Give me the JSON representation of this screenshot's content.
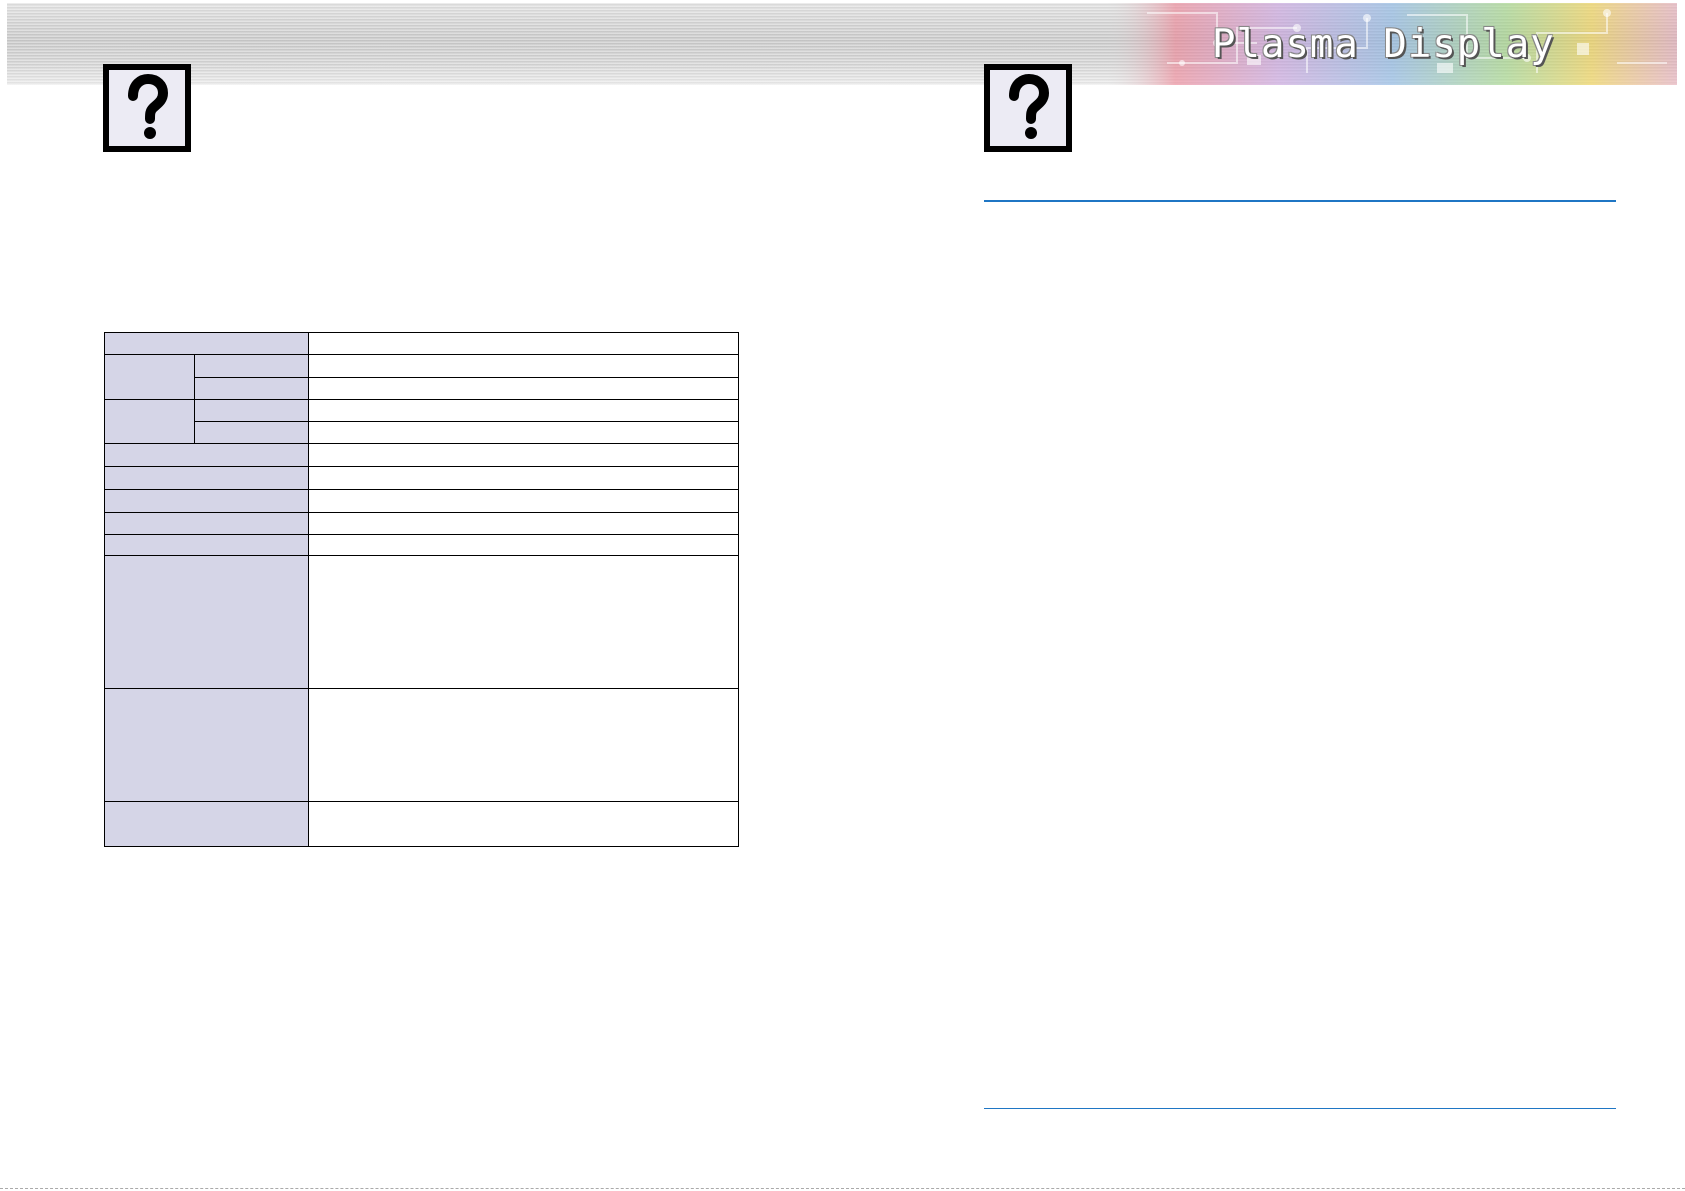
{
  "header": {
    "brand_title": "Plasma Display",
    "art_colors": [
      "#f07a8c",
      "#7fb2e6",
      "#f2d24a",
      "#9ad67a",
      "#c79ae0"
    ]
  },
  "icons": {
    "left": "question-mark-icon",
    "right": "question-mark-icon"
  },
  "colors": {
    "accent_rule": "#1f76c4",
    "label_cell": "#d5d5e7"
  },
  "spec_table": {
    "rows": 14,
    "label_text": "",
    "value_text": ""
  }
}
